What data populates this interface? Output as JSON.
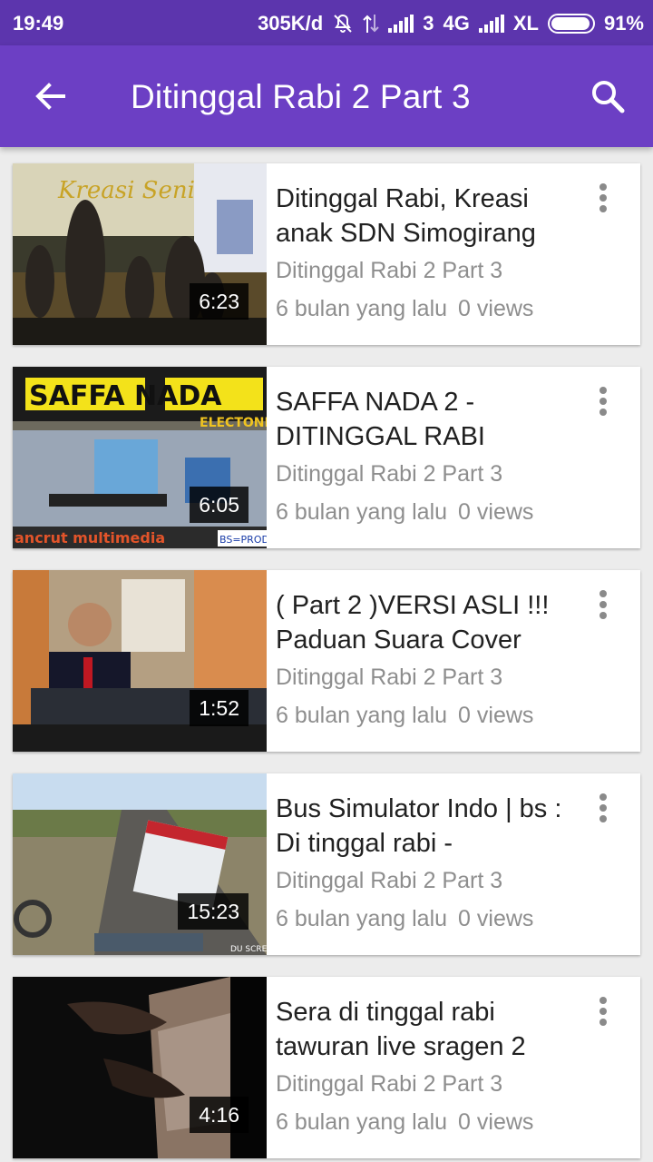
{
  "status_bar": {
    "time": "19:49",
    "speed": "305K/d",
    "sim_label": "3",
    "network": "4G",
    "carrier": "XL",
    "battery": "91%"
  },
  "app_bar": {
    "title": "Ditinggal Rabi 2 Part 3",
    "back_icon": "arrow-back-icon",
    "search_icon": "search-icon"
  },
  "videos": [
    {
      "title": "Ditinggal Rabi, Kreasi anak SDN Simogirang",
      "channel": "Ditinggal Rabi 2 Part 3",
      "age": "6 bulan yang lalu",
      "views": "0 views",
      "duration": "6:23",
      "thumb_text": "Kreasi Seni"
    },
    {
      "title": "SAFFA NADA 2 - DITINGGAL RABI",
      "channel": "Ditinggal Rabi 2 Part 3",
      "age": "6 bulan yang lalu",
      "views": "0 views",
      "duration": "6:05",
      "thumb_text": "SAFFA NADA",
      "thumb_sub": "ELECTONE",
      "thumb_footer": "ancrut multimedia",
      "thumb_badge": "BS=PRODI"
    },
    {
      "title": "( Part 2 )VERSI ASLI !!! Paduan Suara Cover",
      "channel": "Ditinggal Rabi 2 Part 3",
      "age": "6 bulan yang lalu",
      "views": "0 views",
      "duration": "1:52"
    },
    {
      "title": "Bus Simulator Indo | bs : Di tinggal rabi -",
      "channel": "Ditinggal Rabi 2 Part 3",
      "age": "6 bulan yang lalu",
      "views": "0 views",
      "duration": "15:23",
      "thumb_badge": "DU SCREEN"
    },
    {
      "title": "Sera di tinggal rabi tawuran live sragen 2",
      "channel": "Ditinggal Rabi 2 Part 3",
      "age": "6 bulan yang lalu",
      "views": "0 views",
      "duration": "4:16"
    }
  ]
}
